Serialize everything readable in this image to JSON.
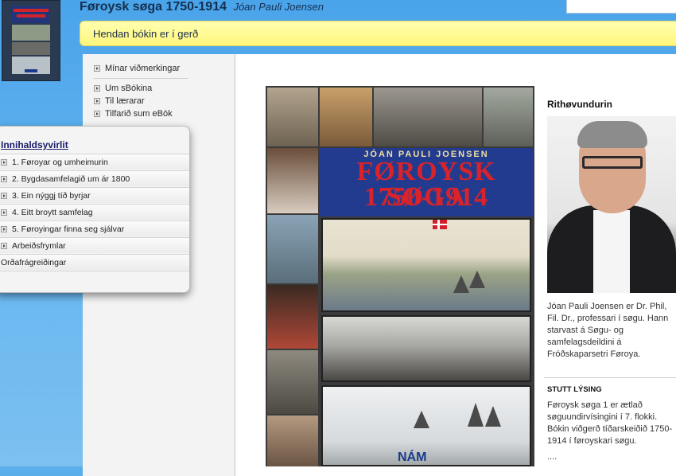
{
  "header": {
    "title": "Føroysk søga 1750-1914",
    "author": "Jóan Pauli Joensen",
    "search_placeholder": ""
  },
  "notice": "Hendan bókin er í gerð",
  "nav": {
    "items": [
      {
        "label": "Mínar viðmerkingar"
      },
      {
        "label": "Um sBókina"
      },
      {
        "label": "Til lærarar"
      },
      {
        "label": "Tilfarið sum eBók"
      }
    ]
  },
  "toc": {
    "heading": "Innihaldsyvirlit",
    "items": [
      {
        "label": "1. Føroyar og umheimurin",
        "arrow": true
      },
      {
        "label": "2. Bygdasamfelagið um ár 1800",
        "arrow": true
      },
      {
        "label": "3. Ein nýggj tíð byrjar",
        "arrow": true
      },
      {
        "label": "4. Eitt broytt samfelag",
        "arrow": true
      },
      {
        "label": "5. Føroyingar finna seg sjálvar",
        "arrow": true
      },
      {
        "label": "Arbeiðsfrymlar",
        "arrow": true
      },
      {
        "label": "Orðafrágreiðingar",
        "arrow": false
      }
    ]
  },
  "cover": {
    "author": "JÓAN PAULI JOENSEN",
    "title": "FØROYSK SØGA",
    "years": "1750-1914",
    "publisher": "NÁM"
  },
  "author_panel": {
    "heading": "Rithøvundurin",
    "bio": "Jóan Pauli Joensen er Dr. Phil, Fil. Dr., professari í søgu. Hann starvast á Søgu- og samfelagsdeildini á Fróðskaparsetri Føroya."
  },
  "summary": {
    "heading": "STUTT LÝSING",
    "body": "Føroysk søga 1 er ætlað søguundirvísingini í 7. flokki. Bókin viðgerð tíðarskeiðið 1750-1914 í føroyskari søgu.",
    "more": "...."
  },
  "colors": {
    "background": "#5aaeea",
    "notice": "#fff67c",
    "cover_band": "#233b8f",
    "cover_title": "#d9232b"
  }
}
